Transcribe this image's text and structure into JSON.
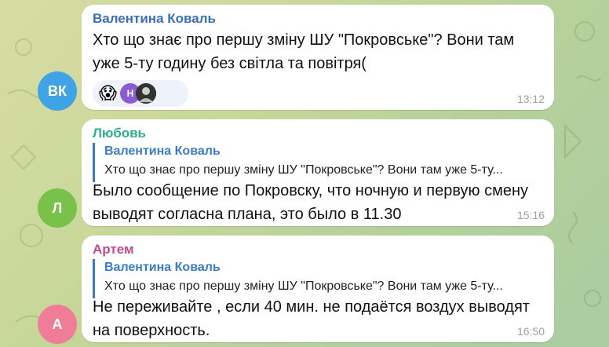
{
  "messages": [
    {
      "avatar_initials": "ВК",
      "sender": "Валентина Коваль",
      "sender_color": "#3a6fb8",
      "text": "Хто що знає про першу зміну ШУ \"Покровське\"? Вони там\nуже 5-ту годину без світла та повітря(",
      "time": "13:12",
      "reactions": {
        "emoji": "😱",
        "mini_avatar_initials": "Н"
      }
    },
    {
      "avatar_initials": "Л",
      "sender": "Любовь",
      "sender_color": "#2eaf8f",
      "reply_name": "Валентина Коваль",
      "reply_text": "Хто що знає про першу зміну ШУ \"Покровське\"? Вони там уже 5-ту...",
      "text": "Было сообщение по Покровску, что ночную и первую смену\nвыводят согласна плана, это было в 11.30",
      "time": "15:16"
    },
    {
      "avatar_initials": "А",
      "sender": "Артем",
      "sender_color": "#c04c8a",
      "reply_name": "Валентина Коваль",
      "reply_text": "Хто що знає про першу зміну ШУ \"Покровське\"? Вони там уже 5-ту...",
      "text": "Не переживайте , если 40 мин. не подаётся воздух выводят\nна поверхность.",
      "time": "16:50"
    }
  ],
  "colors": {
    "avatar_vk": "#3fa3e6",
    "avatar_l": "#79c24a",
    "avatar_a": "#ef7d97",
    "reply_accent": "#3a7bc4",
    "mini_avatar": "#8a5ccf"
  },
  "icons": {
    "reaction_avatar_photo": "person-photo-icon"
  }
}
